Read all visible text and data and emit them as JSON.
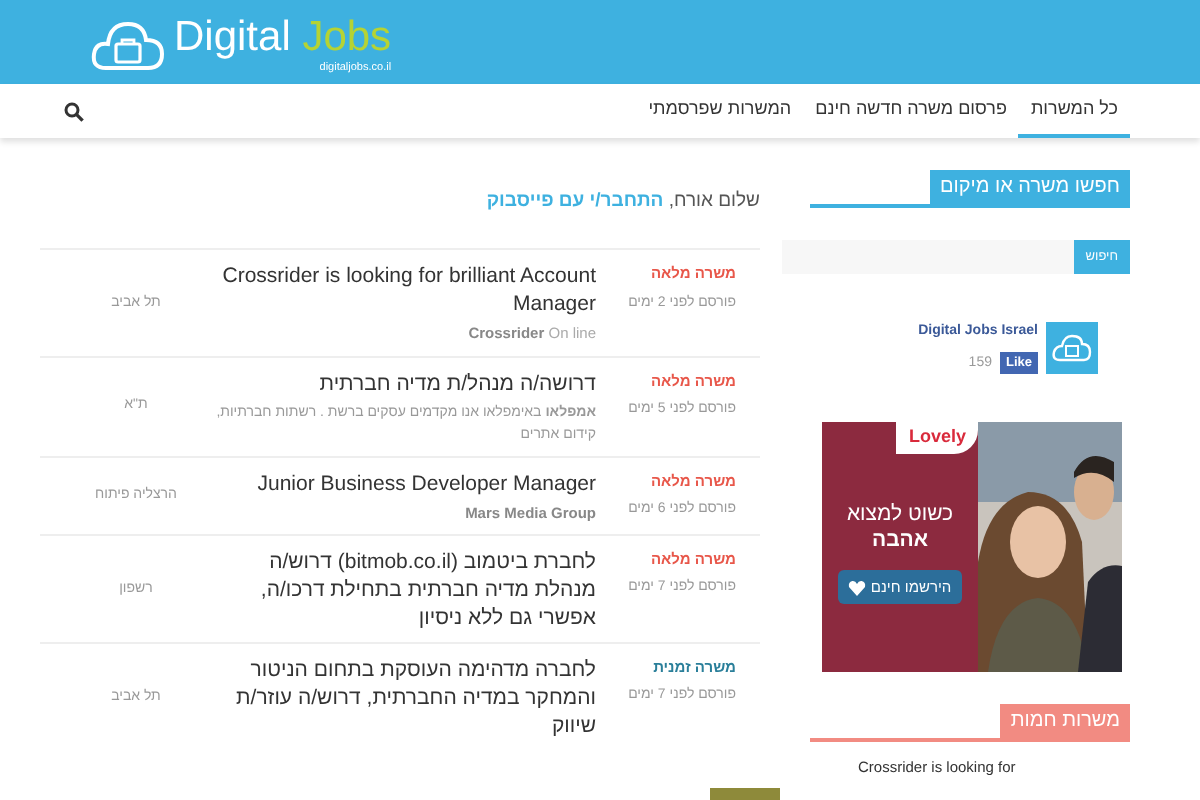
{
  "logo": {
    "word_1": "Digital",
    "word_2": "Jobs",
    "domain": "digitaljobs.co.il"
  },
  "nav": [
    {
      "label": "כל המשרות",
      "selected": true
    },
    {
      "label": "פרסום משרה חדשה חינם",
      "selected": false
    },
    {
      "label": "המשרות שפרסמתי",
      "selected": false
    }
  ],
  "greeting": {
    "text": "שלום  אורח,",
    "link": "התחבר/י עם פייסבוק"
  },
  "jobs": [
    {
      "type": "משרה מלאה",
      "kind": "full",
      "posted": "פורסם לפני 2 ימים",
      "title": "Crossrider is looking for brilliant Account Manager",
      "company": "Crossrider",
      "note": "On line",
      "location": "תל אביב"
    },
    {
      "type": "משרה מלאה",
      "kind": "full",
      "posted": "פורסם לפני 5 ימים",
      "title": "דרושה/ה מנהל/ת מדיה חברתית",
      "description": "**אמפלאו** באימפלאו אנו מקדמים עסקים ברשת . רשתות חברתיות, קידום אתרים",
      "location": "ת\"א"
    },
    {
      "type": "משרה מלאה",
      "kind": "full",
      "posted": "פורסם לפני 6 ימים",
      "title": "Junior Business Developer Manager",
      "company": "Mars Media Group",
      "location": "הרצליה פיתוח"
    },
    {
      "type": "משרה מלאה",
      "kind": "full",
      "posted": "פורסם לפני 7 ימים",
      "title": "לחברת ביטמוב (bitmob.co.il) דרוש/ה מנהלת מדיה חברתית בתחילת דרכו/ה, אפשרי גם ללא ניסיון",
      "location": "רשפון"
    },
    {
      "type": "משרה זמנית",
      "kind": "temp",
      "posted": "פורסם לפני 7 ימים",
      "title": "לחברה מדהימה העוסקת בתחום הניטור והמחקר במדיה החברתית, דרוש/ה עוזר/ת שיווק",
      "location": "תל אביב"
    }
  ],
  "sidebar": {
    "search_heading": "חפשו משרה או מיקום",
    "search_button": "חיפוש",
    "facebook": {
      "page": "Digital Jobs Israel",
      "like": "Like",
      "count": "159"
    },
    "ad": {
      "brand": "Lovely",
      "line_1": "כשוט למצוא",
      "line_2": "אהבה",
      "button": "הירשמו חינם"
    },
    "hot_heading": "משרות חמות",
    "hot_jobs": [
      "Crossrider is looking for"
    ]
  }
}
